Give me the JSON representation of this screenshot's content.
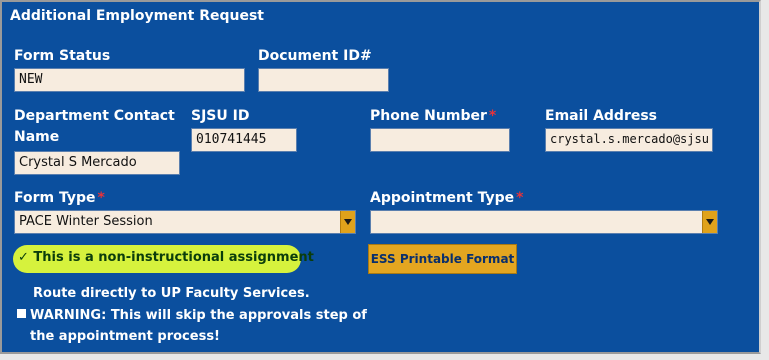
{
  "header": {
    "title": "Additional Employment Request"
  },
  "form_status": {
    "label": "Form Status",
    "value": "NEW"
  },
  "document_id": {
    "label": "Document ID#",
    "value": ""
  },
  "department_contact": {
    "label_line1": "Department Contact",
    "label_line2": "Name",
    "value": "Crystal S Mercado"
  },
  "sjsu_id": {
    "label": "SJSU ID",
    "value": "010741445"
  },
  "phone": {
    "label": "Phone Number",
    "required": "*",
    "value": ""
  },
  "email": {
    "label": "Email Address",
    "value": "crystal.s.mercado@sjsu"
  },
  "form_type": {
    "label": "Form Type",
    "required": "*",
    "value": "PACE Winter Session"
  },
  "appointment_type": {
    "label": "Appointment Type",
    "required": "*",
    "value": ""
  },
  "non_instructional": {
    "text": "✓ This is a non-instructional assignment"
  },
  "ess_button": {
    "label": "ESS Printable Format"
  },
  "route": {
    "text": "Route directly to UP Faculty Services."
  },
  "warning": {
    "line1": "WARNING: This will skip the approvals step of",
    "line2": "the appointment process!"
  },
  "colors": {
    "panel": "#0b4f9e",
    "field": "#f7ecdf",
    "accent": "#e4a620",
    "highlight": "#d6f23d",
    "required": "#e8333a"
  }
}
